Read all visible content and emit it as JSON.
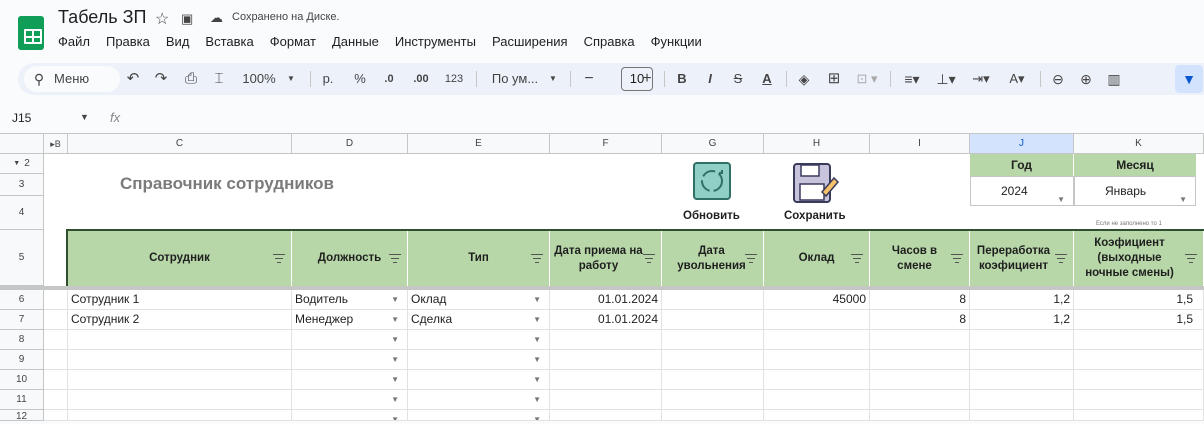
{
  "doc": {
    "title": "Табель ЗП",
    "saved_status": "Сохранено на Диске."
  },
  "menu": [
    "Файл",
    "Правка",
    "Вид",
    "Вставка",
    "Формат",
    "Данные",
    "Инструменты",
    "Расширения",
    "Справка",
    "Функции"
  ],
  "toolbar": {
    "menu_search": "Меню",
    "zoom": "100%",
    "currency": "р.",
    "percent": "%",
    "dec_less": ".0",
    "dec_more": ".00",
    "num_format": "123",
    "font": "По ум...",
    "font_size": "10",
    "bold": "B",
    "italic": "I",
    "strike": "S",
    "text_color": "A"
  },
  "formula": {
    "cell_ref": "J15",
    "fx": "fx",
    "value": ""
  },
  "columns": [
    "C",
    "D",
    "E",
    "F",
    "G",
    "H",
    "I",
    "J",
    "K"
  ],
  "hidden_col_marker": "B",
  "rows": [
    "2",
    "3",
    "4",
    "5",
    "6",
    "7",
    "8",
    "9",
    "10",
    "11",
    "12"
  ],
  "sheet": {
    "heading": "Справочник сотрудников",
    "refresh_label": "Обновить",
    "save_label": "Сохранить",
    "year_label": "Год",
    "month_label": "Месяц",
    "year_value": "2024",
    "month_value": "Январь",
    "note": "Если не заполнено то 1",
    "headers": [
      "Сотрудник",
      "Должность",
      "Тип",
      "Дата приема на работу",
      "Дата увольнения",
      "Оклад",
      "Часов в смене",
      "Переработка коэфициент",
      "Коэфициент (выходные ночные смены)"
    ],
    "data": [
      [
        "Сотрудник 1",
        "Водитель",
        "Оклад",
        "01.01.2024",
        "",
        "45000",
        "8",
        "1,2",
        "1,5"
      ],
      [
        "Сотрудник 2",
        "Менеджер",
        "Сделка",
        "01.01.2024",
        "",
        "",
        "8",
        "1,2",
        "1,5"
      ]
    ]
  },
  "colors": {
    "header_green": "#b7d7a8",
    "selected_col": "#d3e3fd",
    "sheets_logo": "#0f9d58"
  }
}
